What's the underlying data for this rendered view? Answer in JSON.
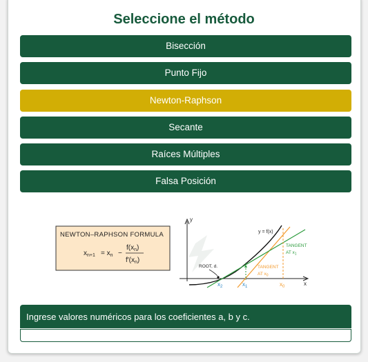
{
  "header": {
    "title": "Seleccione el método"
  },
  "methods": [
    {
      "label": "Bisección",
      "active": false
    },
    {
      "label": "Punto Fijo",
      "active": false
    },
    {
      "label": "Newton-Raphson",
      "active": true
    },
    {
      "label": "Secante",
      "active": false
    },
    {
      "label": "Raíces Múltiples",
      "active": false
    },
    {
      "label": "Falsa Posición",
      "active": false
    }
  ],
  "figure": {
    "formula_title": "NEWTON–RAPHSON  FORMULA",
    "formula_lhs": "x",
    "formula_lhs_sub": "n+1",
    "formula_eq": "= x",
    "formula_eq_sub": "n",
    "formula_minus": "−",
    "formula_num": "f(x",
    "formula_num_sub": "n",
    "formula_num_close": ")",
    "formula_den": "f′(x",
    "formula_den_sub": "n",
    "formula_den_close": ")",
    "axis_y": "y",
    "axis_x": "x",
    "curve_label": "y = f(x)",
    "tangent_x1_line1": "TANGENT",
    "tangent_x1_line2": "AT x",
    "tangent_x1_sub": "1",
    "tangent_x0_line1": "TANGENT",
    "tangent_x0_line2": "AT x",
    "tangent_x0_sub": "0",
    "root_label": "ROOT, d.",
    "x2_label": "x",
    "x2_sub": "2",
    "x1_label": "x",
    "x1_sub": "1",
    "x0_label": "x",
    "x0_sub": "0"
  },
  "colors": {
    "primary": "#175a3c",
    "accent": "#d2ae05",
    "formula_bg": "#fde7c8",
    "tangent_orange": "#f39a2c",
    "tangent_green": "#2c9b3d",
    "x_blue": "#2b86c5"
  },
  "instructions": {
    "text": "Ingrese valores numéricos para los coeficientes a, b y c."
  },
  "coef_input": {
    "value": "",
    "placeholder": ""
  }
}
